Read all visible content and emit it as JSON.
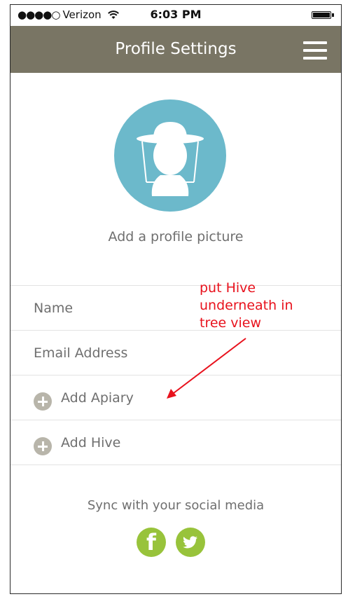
{
  "status_bar": {
    "carrier": "Verizon",
    "time": "6:03 PM"
  },
  "nav": {
    "title": "Profile Settings",
    "menu_icon": "hamburger-icon"
  },
  "profile": {
    "add_photo_label": "Add a profile picture",
    "avatar_color": "#6cb9cb"
  },
  "list": {
    "name_label": "Name",
    "email_label": "Email Address",
    "add_apiary_label": "Add Apiary",
    "add_hive_label": "Add Hive"
  },
  "social": {
    "sync_label": "Sync with your social media",
    "icons": [
      "facebook-icon",
      "twitter-icon"
    ],
    "accent": "#98c33b"
  },
  "annotation": {
    "lines": [
      "put Hive",
      "underneath in",
      "tree view"
    ],
    "color": "#e8121d"
  },
  "colors": {
    "navbar": "#797564",
    "text": "#6f6f6f"
  }
}
